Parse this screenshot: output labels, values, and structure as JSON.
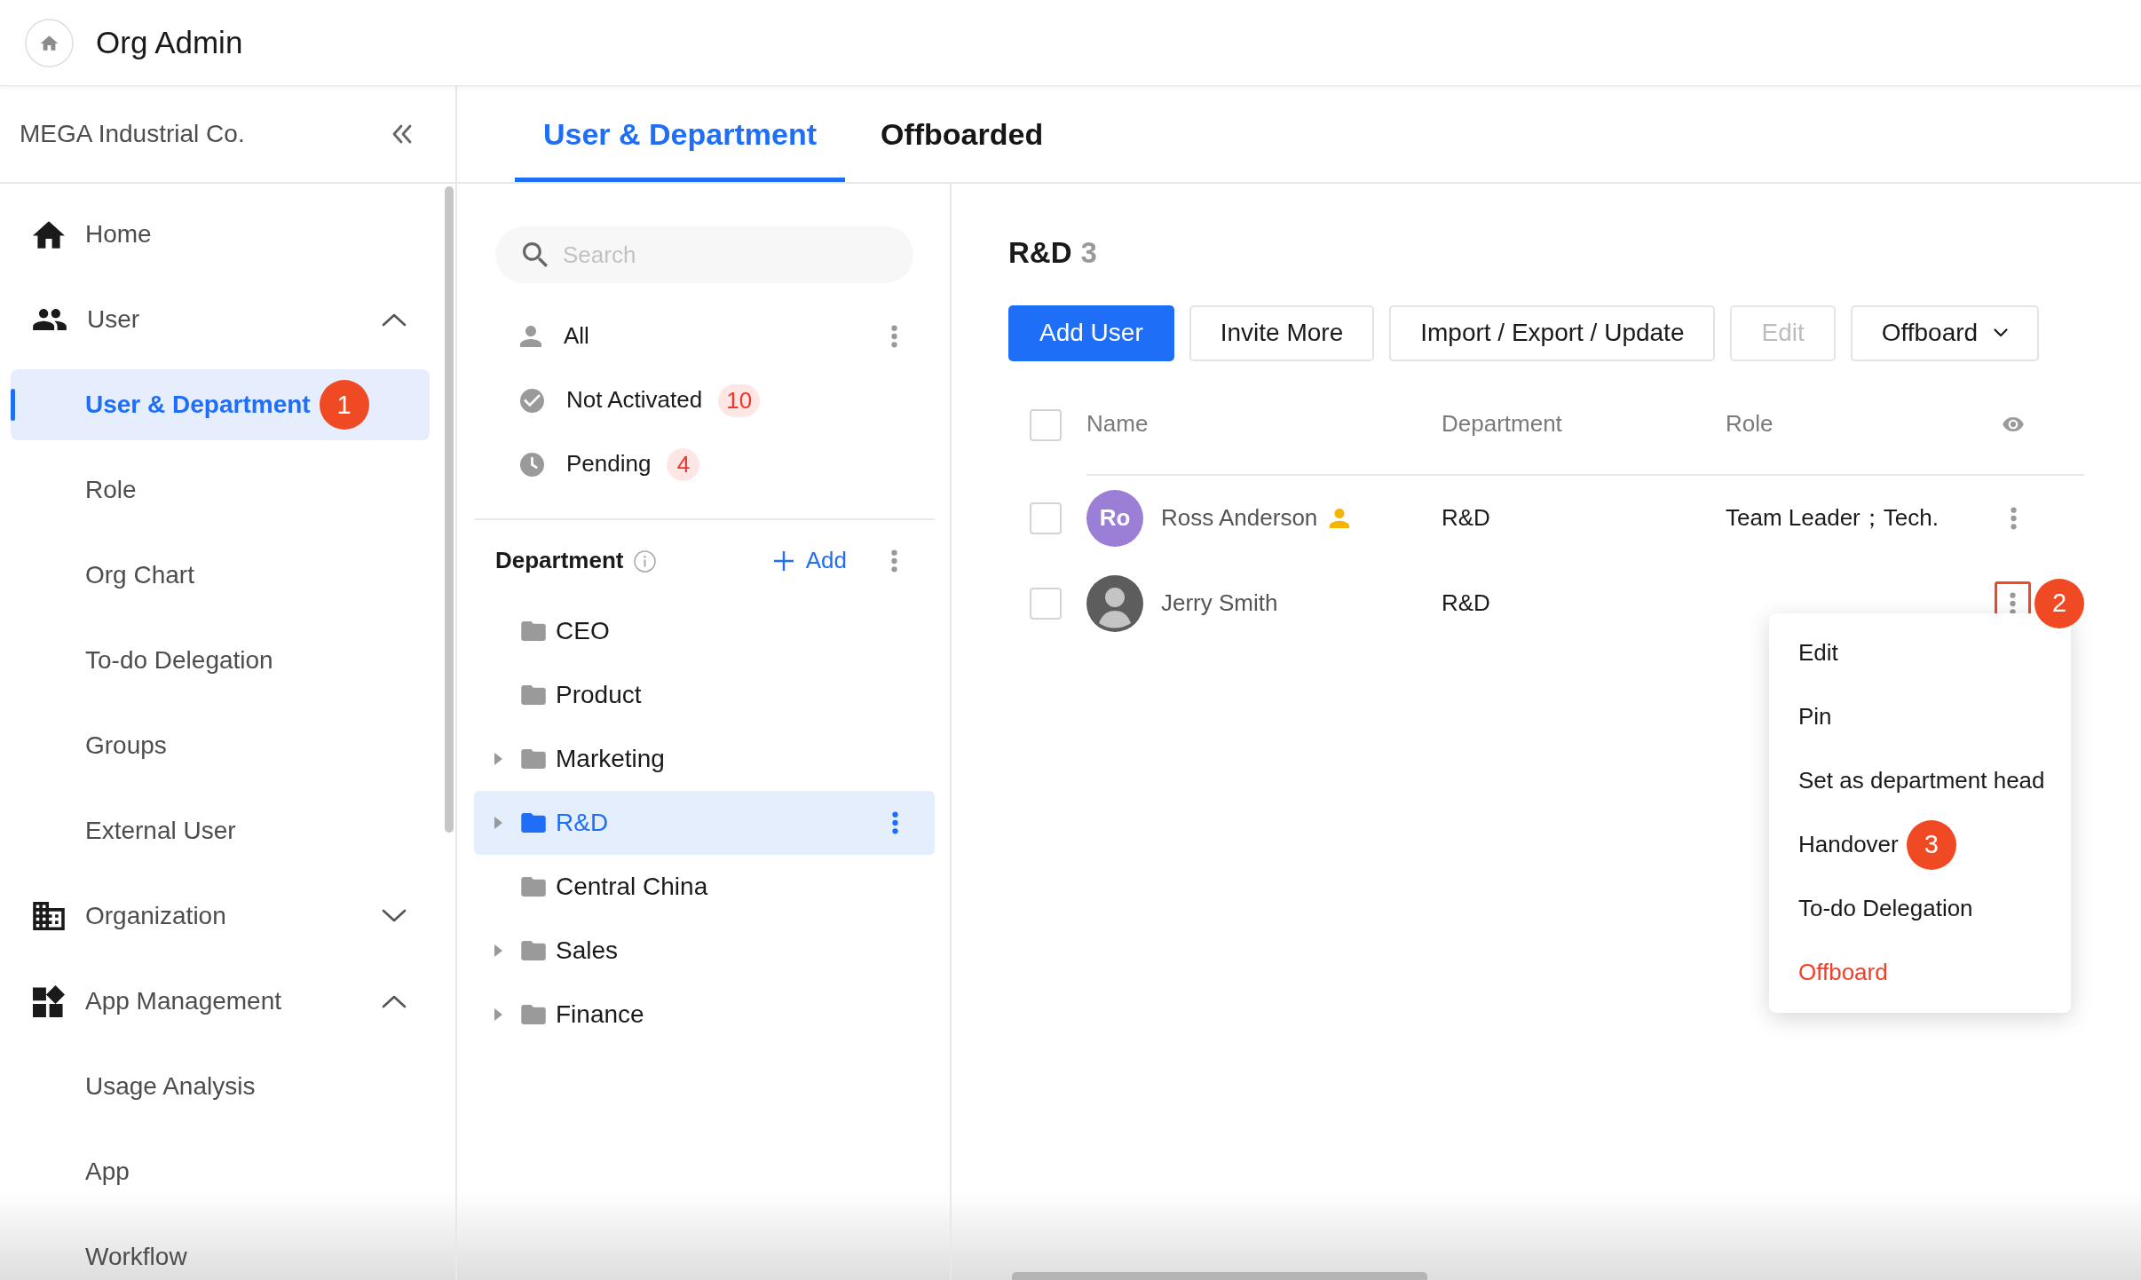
{
  "header": {
    "title": "Org Admin"
  },
  "sidebar": {
    "org_name": "MEGA Industrial Co.",
    "items": [
      {
        "label": "Home",
        "kind": "link"
      },
      {
        "label": "User",
        "kind": "group",
        "expanded": true,
        "children": [
          {
            "label": "User & Department",
            "selected": true,
            "callout": "1"
          },
          {
            "label": "Role",
            "selected": false
          },
          {
            "label": "Org Chart",
            "selected": false
          },
          {
            "label": "To-do Delegation",
            "selected": false
          },
          {
            "label": "Groups",
            "selected": false
          },
          {
            "label": "External User",
            "selected": false
          }
        ]
      },
      {
        "label": "Organization",
        "kind": "group",
        "expanded": false
      },
      {
        "label": "App Management",
        "kind": "group",
        "expanded": true,
        "children": [
          {
            "label": "Usage Analysis",
            "selected": false
          },
          {
            "label": "App",
            "selected": false
          },
          {
            "label": "Workflow",
            "selected": false
          }
        ]
      }
    ]
  },
  "tabs": [
    {
      "label": "User & Department",
      "selected": true
    },
    {
      "label": "Offboarded",
      "selected": false
    }
  ],
  "filter_panel": {
    "search": {
      "placeholder": "Search"
    },
    "filters": [
      {
        "label": "All",
        "selected": false
      },
      {
        "label": "Not Activated",
        "count": "10",
        "selected": false
      },
      {
        "label": "Pending",
        "count": "4",
        "selected": false
      }
    ],
    "departments": {
      "title": "Department",
      "add_label": "Add",
      "items": [
        {
          "label": "CEO",
          "expandable": false,
          "selected": false
        },
        {
          "label": "Product",
          "expandable": false,
          "selected": false
        },
        {
          "label": "Marketing",
          "expandable": true,
          "selected": false
        },
        {
          "label": "R&D",
          "expandable": true,
          "selected": true
        },
        {
          "label": "Central China",
          "expandable": false,
          "selected": false
        },
        {
          "label": "Sales",
          "expandable": true,
          "selected": false
        },
        {
          "label": "Finance",
          "expandable": true,
          "selected": false
        }
      ]
    }
  },
  "user_panel": {
    "title": "R&D",
    "count": "3",
    "buttons": [
      {
        "label": "Add User",
        "kind": "primary",
        "disabled": false
      },
      {
        "label": "Invite More",
        "kind": "default",
        "disabled": false
      },
      {
        "label": "Import / Export / Update",
        "kind": "default",
        "disabled": false
      },
      {
        "label": "Edit",
        "kind": "default",
        "disabled": true
      },
      {
        "label": "Offboard",
        "kind": "dropdown",
        "disabled": false
      }
    ],
    "table": {
      "columns": [
        "Name",
        "Department",
        "Role"
      ],
      "all_checked": false,
      "rows": [
        {
          "kind": "initials",
          "checked": false,
          "initials": "Ro",
          "name": "Ross Anderson",
          "department_head": true,
          "department": "R&D",
          "role": "Team Leader；Tech.",
          "highlighted": false,
          "menu_open": false
        },
        {
          "kind": "photo",
          "checked": false,
          "name": "Jerry Smith",
          "department_head": false,
          "department": "R&D",
          "highlighted": true,
          "callout": "2",
          "menu_open": true
        }
      ]
    },
    "row_menu": [
      {
        "label": "Edit",
        "kind": "normal"
      },
      {
        "label": "Pin",
        "kind": "normal"
      },
      {
        "label": "Set as department head",
        "kind": "normal"
      },
      {
        "label": "Handover",
        "kind": "normal",
        "callout": "3"
      },
      {
        "label": "To-do Delegation",
        "kind": "normal"
      },
      {
        "label": "Offboard",
        "kind": "danger"
      }
    ]
  }
}
